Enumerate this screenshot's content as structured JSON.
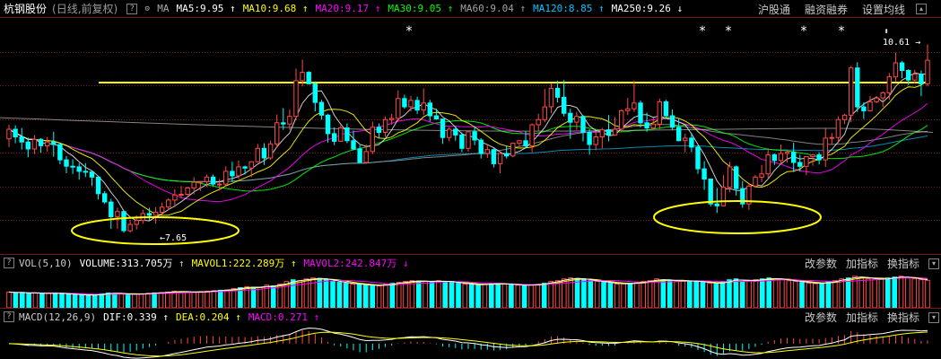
{
  "header": {
    "stock_name": "杭钢股份",
    "period_info": "(日线,前复权)",
    "help_btn": "?",
    "settings_btn": "⚙",
    "ma_label": "MA",
    "ma_items": [
      {
        "label": "MA5:9.95",
        "arrow": "↑",
        "color": "#ffffff"
      },
      {
        "label": "MA10:9.68",
        "arrow": "↑",
        "color": "#ffff00"
      },
      {
        "label": "MA20:9.17",
        "arrow": "↑",
        "color": "#ff00ff"
      },
      {
        "label": "MA30:9.05",
        "arrow": "↑",
        "color": "#00ff00"
      },
      {
        "label": "MA60:9.04",
        "arrow": "↑",
        "color": "#a0a0a0"
      },
      {
        "label": "MA120:8.85",
        "arrow": "↑",
        "color": "#00c8ff"
      },
      {
        "label": "MA250:9.26",
        "arrow": "↓",
        "color": "#ffffff"
      }
    ],
    "menu": [
      "沪股通",
      "融资融券",
      "设置均线"
    ]
  },
  "main_chart": {
    "high_label": "10.61",
    "high_arrow": "→",
    "low_label": "7.65",
    "low_arrow": "←",
    "star": "*",
    "star_count": 6,
    "marker": "⬍"
  },
  "volume_panel": {
    "help_btn": "?",
    "indicator": "VOL(5,10)",
    "volume": {
      "label": "VOLUME:313.705万",
      "arrow": "↑",
      "color": "#ffffff"
    },
    "mavol1": {
      "label": "MAVOL1:222.289万",
      "arrow": "↑",
      "color": "#ffff00"
    },
    "mavol2": {
      "label": "MAVOL2:242.847万",
      "arrow": "↓",
      "color": "#ff00ff"
    },
    "menu": [
      "改参数",
      "加指标",
      "换指标"
    ]
  },
  "macd_panel": {
    "help_btn": "?",
    "indicator": "MACD(12,26,9)",
    "dif": {
      "label": "DIF:0.339",
      "arrow": "↑",
      "color": "#ffffff"
    },
    "dea": {
      "label": "DEA:0.204",
      "arrow": "↑",
      "color": "#ffff00"
    },
    "macd": {
      "label": "MACD:0.271",
      "arrow": "↑",
      "color": "#ff00ff"
    },
    "menu": [
      "改参数",
      "加指标",
      "换指标"
    ]
  },
  "colors": {
    "up": "#ff4848",
    "down": "#00ffff",
    "grid": "#7a1a1a",
    "highlight_line": "#ffff00"
  },
  "chart_data": {
    "type": "candlestick",
    "series_note": "daily OHLC, forward-adjusted",
    "price_range": [
      7.4,
      10.9
    ],
    "candles": [
      [
        9.12,
        9.27,
        9.34,
        8.99
      ],
      [
        9.27,
        9.15,
        9.33,
        9.05
      ],
      [
        9.15,
        9.07,
        9.29,
        8.95
      ],
      [
        9.07,
        8.96,
        9.14,
        8.83
      ],
      [
        8.96,
        9.11,
        9.18,
        8.88
      ],
      [
        9.11,
        9.01,
        9.13,
        8.9
      ],
      [
        9.01,
        9.07,
        9.15,
        8.92
      ],
      [
        9.07,
        9.03,
        9.23,
        8.84
      ],
      [
        9.03,
        8.79,
        9.03,
        8.72
      ],
      [
        8.79,
        8.69,
        8.85,
        8.58
      ],
      [
        8.69,
        8.68,
        8.8,
        8.57
      ],
      [
        8.68,
        8.61,
        8.74,
        8.48
      ],
      [
        8.61,
        8.6,
        8.74,
        8.52
      ],
      [
        8.6,
        8.52,
        8.62,
        8.38
      ],
      [
        8.52,
        8.26,
        8.52,
        8.17
      ],
      [
        8.26,
        8.13,
        8.3,
        8.1
      ],
      [
        8.13,
        7.9,
        8.18,
        7.71
      ],
      [
        7.9,
        7.98,
        8.04,
        7.71
      ],
      [
        7.98,
        7.68,
        8,
        7.65
      ],
      [
        7.68,
        7.78,
        7.85,
        7.65
      ],
      [
        7.78,
        7.84,
        7.92,
        7.7
      ],
      [
        7.84,
        7.95,
        8.01,
        7.79
      ],
      [
        7.95,
        7.92,
        8.04,
        7.84
      ],
      [
        7.92,
        7.97,
        8.05,
        7.79
      ],
      [
        7.97,
        8.05,
        8.12,
        7.93
      ],
      [
        8.05,
        8.16,
        8.19,
        8
      ],
      [
        8.16,
        8.24,
        8.33,
        8.05
      ],
      [
        8.24,
        8.25,
        8.38,
        8.19
      ],
      [
        8.25,
        8.35,
        8.37,
        8.23
      ],
      [
        8.35,
        8.44,
        8.52,
        8.25
      ],
      [
        8.44,
        8.45,
        8.46,
        8.3
      ],
      [
        8.45,
        8.52,
        8.56,
        8.37
      ],
      [
        8.52,
        8.41,
        8.56,
        8.38
      ],
      [
        8.41,
        8.41,
        8.49,
        8.31
      ],
      [
        8.41,
        8.61,
        8.69,
        8.39
      ],
      [
        8.61,
        8.54,
        8.76,
        8.44
      ],
      [
        8.54,
        8.68,
        8.78,
        8.49
      ],
      [
        8.68,
        8.66,
        8.7,
        8.56
      ],
      [
        8.66,
        8.76,
        8.77,
        8.52
      ],
      [
        8.76,
        8.97,
        9.04,
        8.75
      ],
      [
        8.97,
        8.82,
        9.05,
        8.71
      ],
      [
        8.82,
        9.04,
        9.09,
        8.79
      ],
      [
        9.04,
        9.37,
        9.5,
        8.98
      ],
      [
        9.37,
        9.35,
        9.6,
        9.26
      ],
      [
        9.35,
        9.47,
        9.58,
        9.26
      ],
      [
        9.47,
        10.03,
        10.22,
        9.41
      ],
      [
        10.03,
        10.16,
        10.36,
        9.94
      ],
      [
        10.16,
        9.98,
        10.18,
        9.97
      ],
      [
        9.98,
        9.69,
        10.02,
        9.55
      ],
      [
        9.69,
        9.49,
        9.73,
        9.42
      ],
      [
        9.49,
        9.2,
        9.51,
        9.06
      ],
      [
        9.2,
        9.08,
        9.3,
        9.02
      ],
      [
        9.08,
        9.29,
        9.33,
        9.07
      ],
      [
        9.29,
        9.09,
        9.36,
        9.05
      ],
      [
        9.09,
        8.96,
        9.25,
        8.94
      ],
      [
        8.96,
        8.75,
        9.02,
        8.75
      ],
      [
        8.75,
        8.92,
        9.03,
        8.73
      ],
      [
        8.92,
        9.3,
        9.39,
        8.88
      ],
      [
        9.3,
        9.22,
        9.36,
        9.13
      ],
      [
        9.22,
        9.42,
        9.47,
        9.15
      ],
      [
        9.42,
        9.44,
        9.51,
        9.34
      ],
      [
        9.44,
        9.75,
        9.88,
        9.39
      ],
      [
        9.75,
        9.62,
        9.81,
        9.59
      ],
      [
        9.62,
        9.72,
        9.79,
        9.55
      ],
      [
        9.72,
        9.57,
        9.78,
        9.51
      ],
      [
        9.57,
        9.68,
        9.91,
        9.49
      ],
      [
        9.68,
        9.48,
        9.73,
        9.39
      ],
      [
        9.48,
        9.43,
        9.59,
        9.42
      ],
      [
        9.43,
        9.14,
        9.43,
        9.04
      ],
      [
        9.14,
        9.27,
        9.3,
        9.08
      ],
      [
        9.27,
        9.18,
        9.32,
        9.09
      ],
      [
        9.18,
        8.97,
        9.22,
        8.91
      ],
      [
        8.97,
        9.23,
        9.25,
        8.92
      ],
      [
        9.23,
        9.1,
        9.32,
        9.02
      ],
      [
        9.1,
        8.89,
        9.13,
        8.81
      ],
      [
        8.89,
        8.95,
        9.04,
        8.82
      ],
      [
        8.95,
        8.73,
        8.97,
        8.67
      ],
      [
        8.73,
        8.89,
        8.92,
        8.58
      ],
      [
        8.89,
        8.85,
        9.01,
        8.81
      ],
      [
        8.85,
        9.05,
        9.06,
        8.83
      ],
      [
        9.05,
        9.09,
        9.1,
        9.01
      ],
      [
        9.09,
        9.01,
        9.24,
        8.97
      ],
      [
        9.01,
        9.34,
        9.36,
        8.91
      ],
      [
        9.34,
        9.42,
        9.51,
        9.24
      ],
      [
        9.42,
        9.62,
        9.9,
        9.38
      ],
      [
        9.62,
        9.91,
        9.99,
        9.52
      ],
      [
        9.91,
        9.77,
        10.03,
        9.69
      ],
      [
        9.77,
        9.52,
        10.04,
        9.47
      ],
      [
        9.52,
        9.38,
        9.59,
        9.12
      ],
      [
        9.38,
        9.47,
        9.54,
        9.26
      ],
      [
        9.47,
        9.22,
        9.49,
        9.08
      ],
      [
        9.22,
        9.03,
        9.27,
        8.87
      ],
      [
        9.03,
        9.15,
        9.23,
        8.94
      ],
      [
        9.15,
        9.26,
        9.29,
        8.97
      ],
      [
        9.26,
        9.18,
        9.49,
        9.08
      ],
      [
        9.18,
        9.27,
        9.46,
        9.17
      ],
      [
        9.27,
        9.56,
        9.58,
        9.23
      ],
      [
        9.56,
        9.59,
        9.76,
        9.49
      ],
      [
        9.59,
        9.68,
        10.03,
        9.54
      ],
      [
        9.68,
        9.37,
        9.72,
        9.3
      ],
      [
        9.37,
        9.29,
        9.53,
        9.23
      ],
      [
        9.29,
        9.35,
        9.45,
        9.27
      ],
      [
        9.35,
        9.7,
        9.75,
        9.27
      ],
      [
        9.7,
        9.48,
        9.73,
        9.43
      ],
      [
        9.48,
        9.3,
        9.58,
        9.26
      ],
      [
        9.3,
        9.09,
        9.44,
        9.08
      ],
      [
        9.09,
        9.13,
        9.2,
        8.91
      ],
      [
        9.13,
        8.99,
        9.21,
        8.91
      ],
      [
        8.99,
        8.65,
        9.01,
        8.57
      ],
      [
        8.65,
        8.49,
        8.77,
        8.32
      ],
      [
        8.49,
        8.1,
        8.49,
        8.06
      ],
      [
        8.1,
        8.07,
        8.35,
        7.96
      ],
      [
        8.07,
        8.36,
        8.55,
        8.06
      ],
      [
        8.36,
        8.68,
        8.76,
        8.28
      ],
      [
        8.68,
        8.34,
        8.7,
        8.23
      ],
      [
        8.34,
        8.1,
        8.46,
        8.04
      ],
      [
        8.1,
        8.38,
        8.41,
        8.01
      ],
      [
        8.38,
        8.52,
        8.55,
        8.35
      ],
      [
        8.52,
        8.57,
        8.71,
        8.44
      ],
      [
        8.57,
        8.87,
        8.97,
        8.48
      ],
      [
        8.87,
        8.78,
        8.89,
        8.71
      ],
      [
        8.78,
        8.89,
        9.03,
        8.72
      ],
      [
        8.89,
        8.91,
        8.95,
        8.75
      ],
      [
        8.91,
        8.75,
        9.06,
        8.6
      ],
      [
        8.75,
        8.69,
        8.87,
        8.61
      ],
      [
        8.69,
        8.84,
        8.85,
        8.55
      ],
      [
        8.84,
        8.87,
        8.88,
        8.7
      ],
      [
        8.87,
        8.79,
        8.91,
        8.72
      ],
      [
        8.79,
        9.13,
        9.28,
        8.68
      ],
      [
        9.13,
        9.14,
        9.21,
        9.03
      ],
      [
        9.14,
        9.42,
        9.47,
        9.05
      ],
      [
        9.42,
        9.49,
        9.51,
        9.35
      ],
      [
        9.49,
        10.23,
        10.26,
        9.38
      ],
      [
        10.23,
        9.62,
        10.32,
        9.54
      ],
      [
        9.62,
        9.56,
        9.69,
        9.43
      ],
      [
        9.56,
        9.7,
        9.79,
        9.55
      ],
      [
        9.7,
        9.76,
        9.79,
        9.68
      ],
      [
        9.76,
        9.84,
        9.86,
        9.62
      ],
      [
        9.84,
        10.09,
        10.15,
        9.73
      ],
      [
        10.09,
        10.31,
        10.47,
        10.01
      ],
      [
        10.31,
        10.19,
        10.34,
        10.07
      ],
      [
        10.19,
        10.04,
        10.21,
        9.96
      ],
      [
        10.04,
        10.13,
        10.2,
        9.99
      ],
      [
        10.13,
        9.98,
        10.19,
        9.79
      ],
      [
        9.98,
        10.35,
        10.6,
        9.94
      ]
    ],
    "volume": [
      180,
      170,
      175,
      165,
      170,
      160,
      165,
      170,
      160,
      155,
      150,
      145,
      140,
      150,
      160,
      170,
      165,
      160,
      150,
      155,
      160,
      165,
      170,
      175,
      180,
      190,
      185,
      180,
      175,
      185,
      190,
      195,
      200,
      205,
      220,
      230,
      240,
      235,
      230,
      260,
      250,
      270,
      300,
      320,
      310,
      330,
      340,
      335,
      320,
      300,
      290,
      280,
      270,
      265,
      260,
      255,
      250,
      270,
      280,
      290,
      300,
      310,
      305,
      300,
      295,
      310,
      300,
      290,
      280,
      270,
      265,
      260,
      270,
      280,
      275,
      270,
      265,
      260,
      255,
      260,
      270,
      280,
      300,
      310,
      330,
      340,
      335,
      320,
      310,
      300,
      290,
      280,
      270,
      275,
      280,
      290,
      300,
      310,
      330,
      320,
      310,
      300,
      310,
      305,
      300,
      290,
      280,
      270,
      300,
      320,
      330,
      300,
      310,
      320,
      330,
      340,
      330,
      320,
      310,
      300,
      290,
      280,
      275,
      280,
      300,
      310,
      330,
      340,
      360,
      350,
      330,
      320,
      330,
      340,
      350,
      360,
      340,
      330,
      320,
      313.705
    ]
  }
}
